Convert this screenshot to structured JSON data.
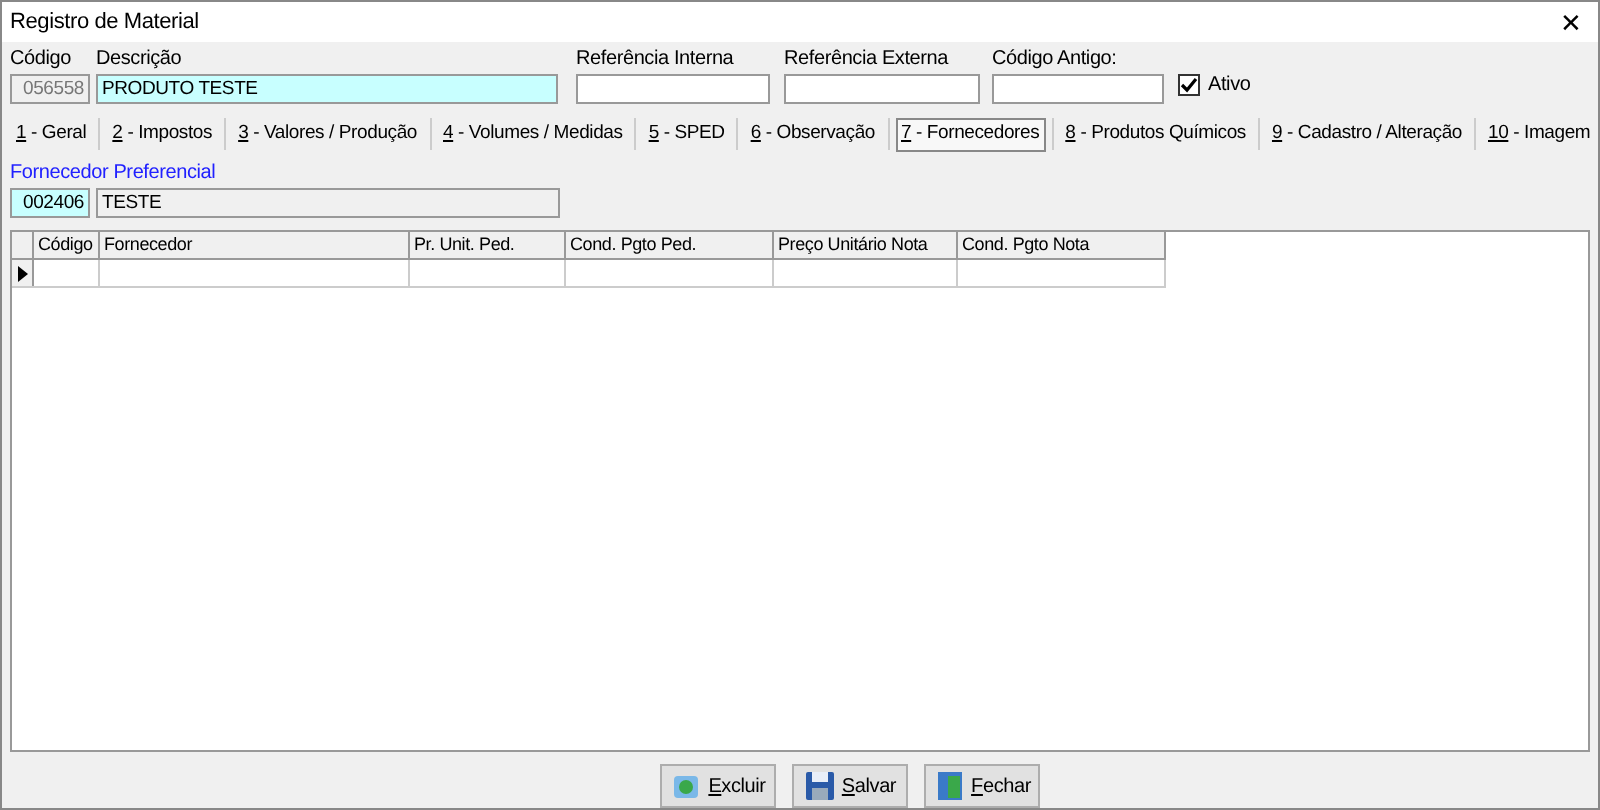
{
  "window": {
    "title": "Registro de Material",
    "close": "✕"
  },
  "fields": [
    {
      "label": "Código",
      "value": "056558",
      "kind": "readonly"
    },
    {
      "label": "Descrição",
      "value": "PRODUTO TESTE",
      "kind": "highlight"
    },
    {
      "label": "Referência Interna",
      "kind": "normal"
    },
    {
      "label": "Referência Externa",
      "kind": "normal"
    },
    {
      "label": "Código Antigo:",
      "kind": "normal"
    }
  ],
  "active": {
    "label": "Ativo",
    "checked": true
  },
  "tabs": [
    {
      "key": "1",
      "text": " - Geral",
      "selected": false
    },
    {
      "key": "2",
      "text": " - Impostos",
      "selected": false
    },
    {
      "key": "3",
      "text": " - Valores / Produção",
      "selected": false
    },
    {
      "key": "4",
      "text": " - Volumes / Medidas",
      "selected": false
    },
    {
      "key": "5",
      "text": " - SPED",
      "selected": false
    },
    {
      "key": "6",
      "text": " - Observação",
      "selected": false
    },
    {
      "key": "7",
      "text": " - Fornecedores",
      "selected": true
    },
    {
      "key": "8",
      "text": " - Produtos Químicos",
      "selected": false
    },
    {
      "key": "9",
      "text": " - Cadastro / Alteração",
      "selected": false
    },
    {
      "key": "10",
      "text": " - Imagem",
      "selected": false
    }
  ],
  "preferred_supplier": {
    "label": "Fornecedor Preferencial",
    "code": "002406",
    "name": "TESTE"
  },
  "table": {
    "columns": [
      "Código",
      "Fornecedor",
      "Pr. Unit. Ped.",
      "Cond. Pgto Ped.",
      "Preço Unitário Nota",
      "Cond. Pgto Nota"
    ]
  },
  "buttons": [
    {
      "kind": "delete",
      "accel": "E",
      "text": "xcluir"
    },
    {
      "kind": "save",
      "accel": "S",
      "text": "alvar"
    },
    {
      "kind": "close",
      "accel": "F",
      "text": "echar"
    }
  ]
}
